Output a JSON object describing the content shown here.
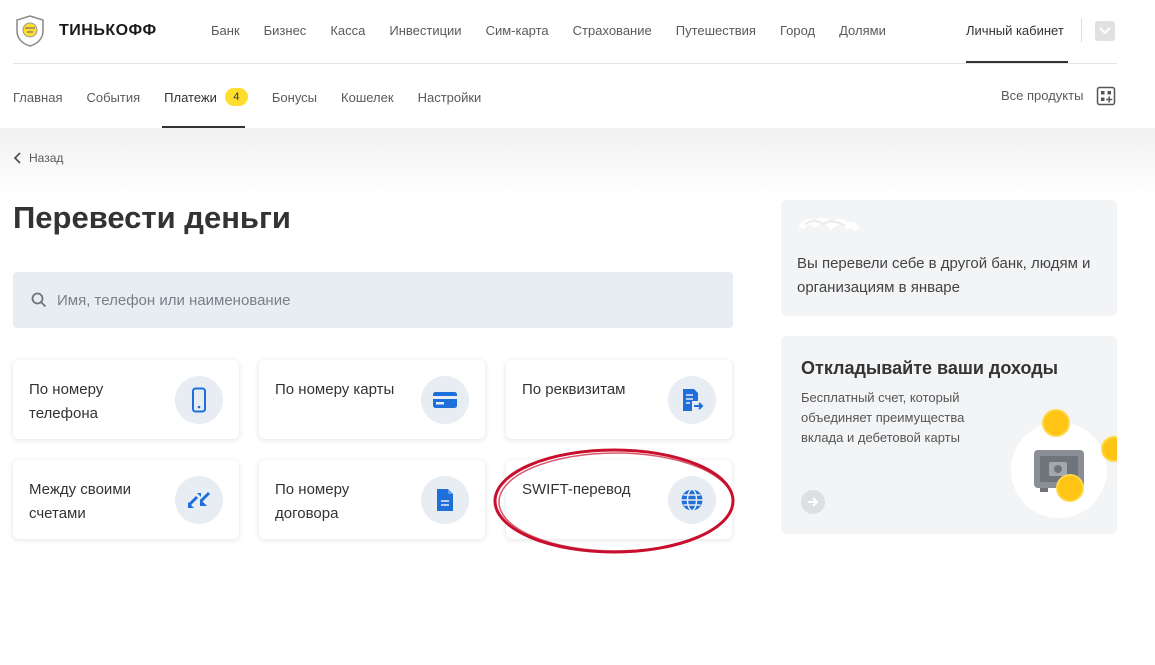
{
  "header": {
    "logo_text": "ТИНЬКОФФ",
    "nav": [
      "Банк",
      "Бизнес",
      "Касса",
      "Инвестиции",
      "Сим-карта",
      "Страхование",
      "Путешествия",
      "Город",
      "Долями"
    ],
    "cabinet": "Личный кабинет"
  },
  "subnav": {
    "items": [
      "Главная",
      "События",
      "Платежи",
      "Бонусы",
      "Кошелек",
      "Настройки"
    ],
    "active_index": 2,
    "badge": "4",
    "all_products": "Все продукты"
  },
  "back": "Назад",
  "title": "Перевести деньги",
  "search": {
    "placeholder": "Имя, телефон или наименование"
  },
  "cards": [
    {
      "label": "По номеру телефона",
      "icon": "phone-icon"
    },
    {
      "label": "По номеру карты",
      "icon": "card-icon"
    },
    {
      "label": "По реквизитам",
      "icon": "document-arrow-icon"
    },
    {
      "label": "Между своими счетами",
      "icon": "swap-arrows-icon"
    },
    {
      "label": "По номеру договора",
      "icon": "contract-document-icon"
    },
    {
      "label": "SWIFT-перевод",
      "icon": "globe-icon"
    }
  ],
  "side": {
    "summary_text": "Вы перевели себе в другой банк, людям и организациям в январе",
    "promo_title": "Откладывайте ваши доходы",
    "promo_desc": "Бесплатный счет, который объединяет преимущества вклада и дебетовой карты"
  },
  "colors": {
    "accent_yellow": "#ffdd2d",
    "icon_blue": "#1e6fd9",
    "icon_bg": "#e8edf3",
    "annotation_red": "#c8102e"
  }
}
